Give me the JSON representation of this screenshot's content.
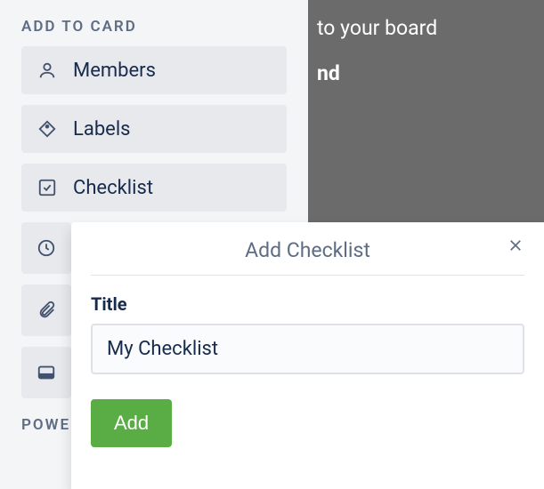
{
  "sidebar": {
    "title": "ADD TO CARD",
    "items": [
      {
        "label": "Members"
      },
      {
        "label": "Labels"
      },
      {
        "label": "Checklist"
      },
      {
        "label": ""
      },
      {
        "label": ""
      },
      {
        "label": ""
      }
    ],
    "section2": "POWE"
  },
  "background": {
    "line1": "to your board",
    "line2": "nd"
  },
  "popover": {
    "title": "Add Checklist",
    "field_label": "Title",
    "input_value": "My Checklist",
    "add_label": "Add"
  }
}
